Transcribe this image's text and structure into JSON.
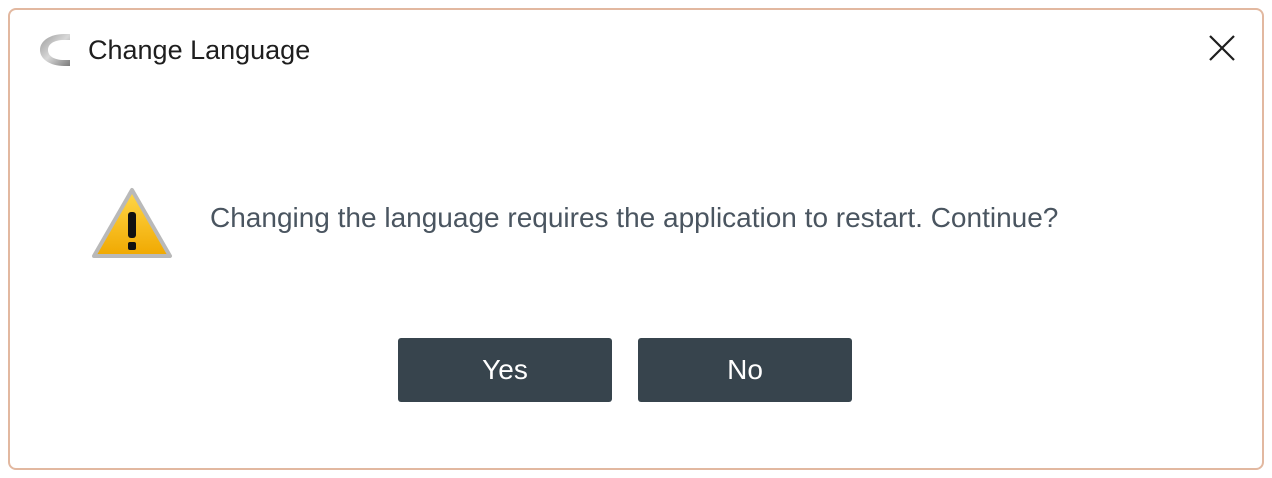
{
  "dialog": {
    "title": "Change Language",
    "message": "Changing the language requires the application to restart. Continue?",
    "buttons": {
      "yes_label": "Yes",
      "no_label": "No"
    },
    "icons": {
      "app": "app-logo-icon",
      "warning": "warning-icon",
      "close": "close-icon"
    },
    "colors": {
      "button_bg": "#37444d",
      "button_text": "#ffffff",
      "message_text": "#4a5560",
      "border": "#e2b8a0",
      "warning_fill": "#f5b800"
    }
  }
}
